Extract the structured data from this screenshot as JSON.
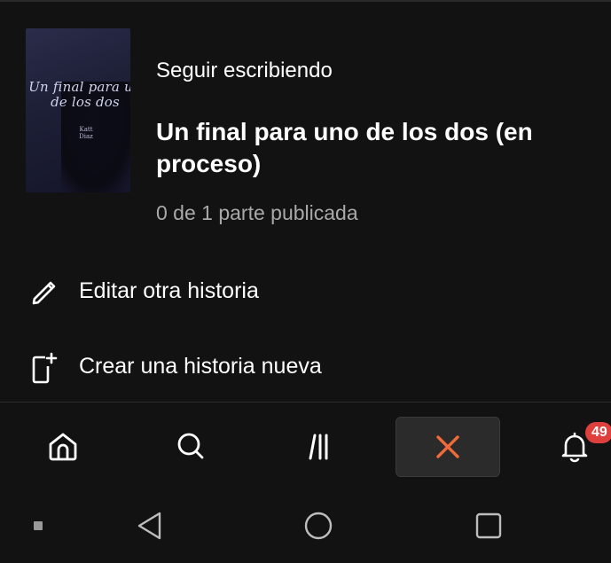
{
  "cover": {
    "title_line1": "Un final para un",
    "title_line2": "de los dos",
    "author_line1": "Katt",
    "author_line2": "Diaz"
  },
  "continue_writing": {
    "label": "Seguir escribiendo",
    "story_title": "Un final para uno de los dos (en proceso)",
    "parts_status": "0 de 1 parte publicada"
  },
  "menu": {
    "edit_other": {
      "label": "Editar otra historia",
      "icon": "pencil-icon"
    },
    "create_new": {
      "label": "Crear una historia nueva",
      "icon": "new-document-icon"
    }
  },
  "bottom_nav": {
    "items": [
      {
        "icon": "home-icon"
      },
      {
        "icon": "search-icon"
      },
      {
        "icon": "library-icon"
      },
      {
        "icon": "close-icon",
        "active": true
      },
      {
        "icon": "bell-icon",
        "badge": "49"
      }
    ],
    "notification_count": "49",
    "accent": "#f06a3a",
    "badge_color": "#e0403c"
  },
  "system_nav": {
    "buttons": [
      "menu-dot-icon",
      "back-icon",
      "home-circle-icon",
      "recents-icon"
    ]
  }
}
